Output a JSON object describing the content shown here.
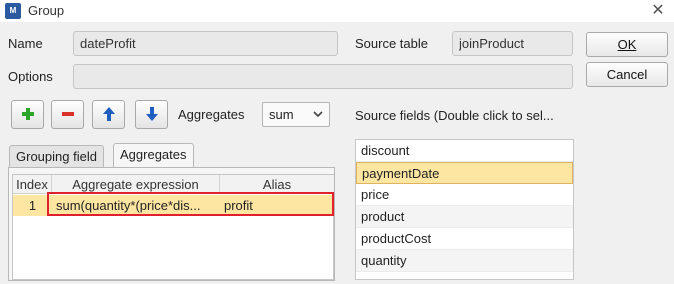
{
  "window": {
    "title": "Group"
  },
  "form": {
    "name_label": "Name",
    "name_value": "dateProfit",
    "source_table_label": "Source table",
    "source_table_value": "joinProduct",
    "options_label": "Options",
    "options_value": ""
  },
  "buttons": {
    "ok": "OK",
    "cancel": "Cancel"
  },
  "toolbar": {
    "aggregates_label": "Aggregates",
    "aggregates_selected": "sum",
    "icons": [
      "plus-icon",
      "minus-icon",
      "arrow-up-icon",
      "arrow-down-icon"
    ]
  },
  "tabs": [
    {
      "label": "Grouping field",
      "active": false
    },
    {
      "label": "Aggregates",
      "active": true
    }
  ],
  "grid": {
    "columns": [
      "Index",
      "Aggregate expression",
      "Alias"
    ],
    "rows": [
      {
        "index": "1",
        "expression": "sum(quantity*(price*dis...",
        "alias": "profit"
      }
    ]
  },
  "source_fields": {
    "label": "Source fields (Double click to sel...",
    "items": [
      "discount",
      "paymentDate",
      "price",
      "product",
      "productCost",
      "quantity"
    ],
    "selected": "paymentDate"
  },
  "colors": {
    "selection": "#fde6a2",
    "highlight_border": "#e0202a",
    "plus": "#2aa52a",
    "minus": "#d9302c",
    "arrow": "#1f5fbf"
  }
}
